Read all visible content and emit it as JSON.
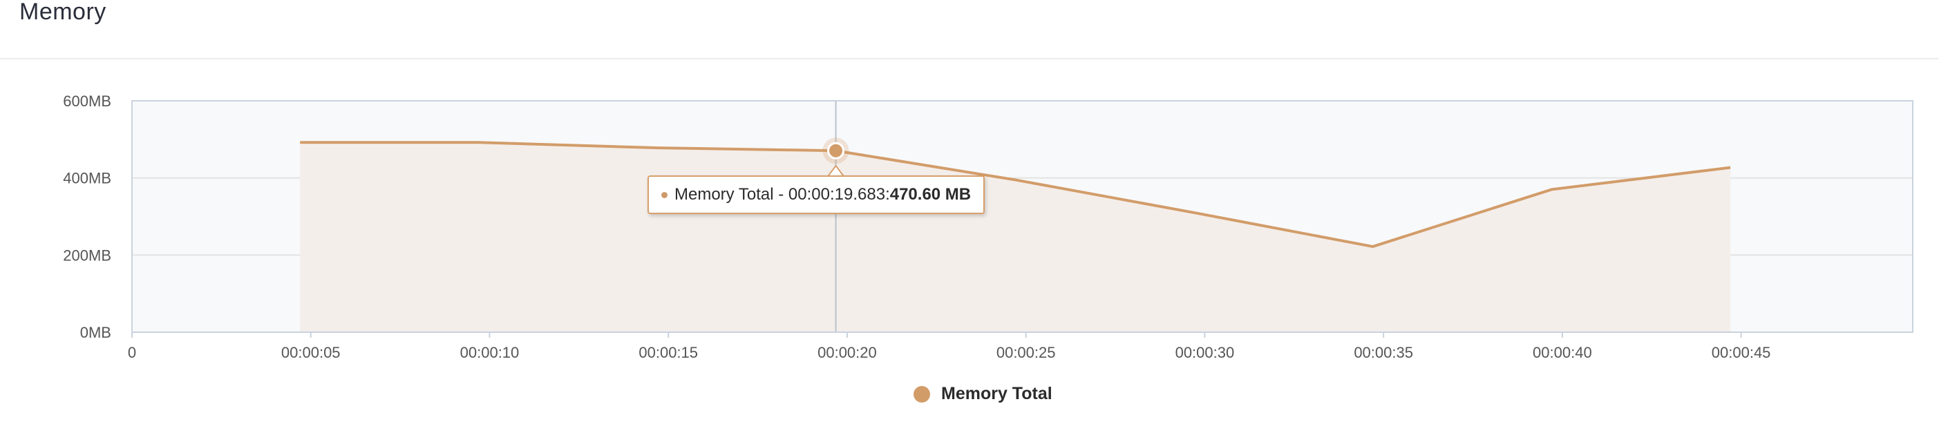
{
  "panel": {
    "title": "Memory"
  },
  "tooltip": {
    "label": "Memory Total - 00:00:19.683: ",
    "value": "470.60 MB"
  },
  "colors": {
    "series": "#d29c69",
    "area": "#f4eeea",
    "plot_bg": "#f8f9fb",
    "plot_border": "#c9d3dd",
    "grid": "#e3e3e3"
  },
  "chart_data": {
    "type": "area",
    "title": "Memory",
    "xlabel": "",
    "ylabel": "",
    "x_ticks": [
      "0",
      "00:00:05",
      "00:00:10",
      "00:00:15",
      "00:00:20",
      "00:00:25",
      "00:00:30",
      "00:00:35",
      "00:00:40",
      "00:00:45"
    ],
    "x_tick_values": [
      0,
      5,
      10,
      15,
      20,
      25,
      30,
      35,
      40,
      45
    ],
    "y_ticks": [
      "0MB",
      "200MB",
      "400MB",
      "600MB"
    ],
    "y_tick_values": [
      0,
      200,
      400,
      600
    ],
    "xlim": [
      0,
      49.8
    ],
    "ylim": [
      0,
      600
    ],
    "grid": true,
    "legend_position": "bottom-center",
    "series": [
      {
        "name": "Memory Total",
        "x": [
          4.7,
          9.7,
          14.7,
          19.683,
          24.7,
          29.7,
          34.7,
          39.7,
          44.7
        ],
        "values": [
          492,
          492,
          478,
          470.6,
          395,
          310,
          222,
          370,
          427
        ]
      }
    ],
    "highlighted_point": {
      "x": 19.683,
      "y": 470.6
    }
  }
}
